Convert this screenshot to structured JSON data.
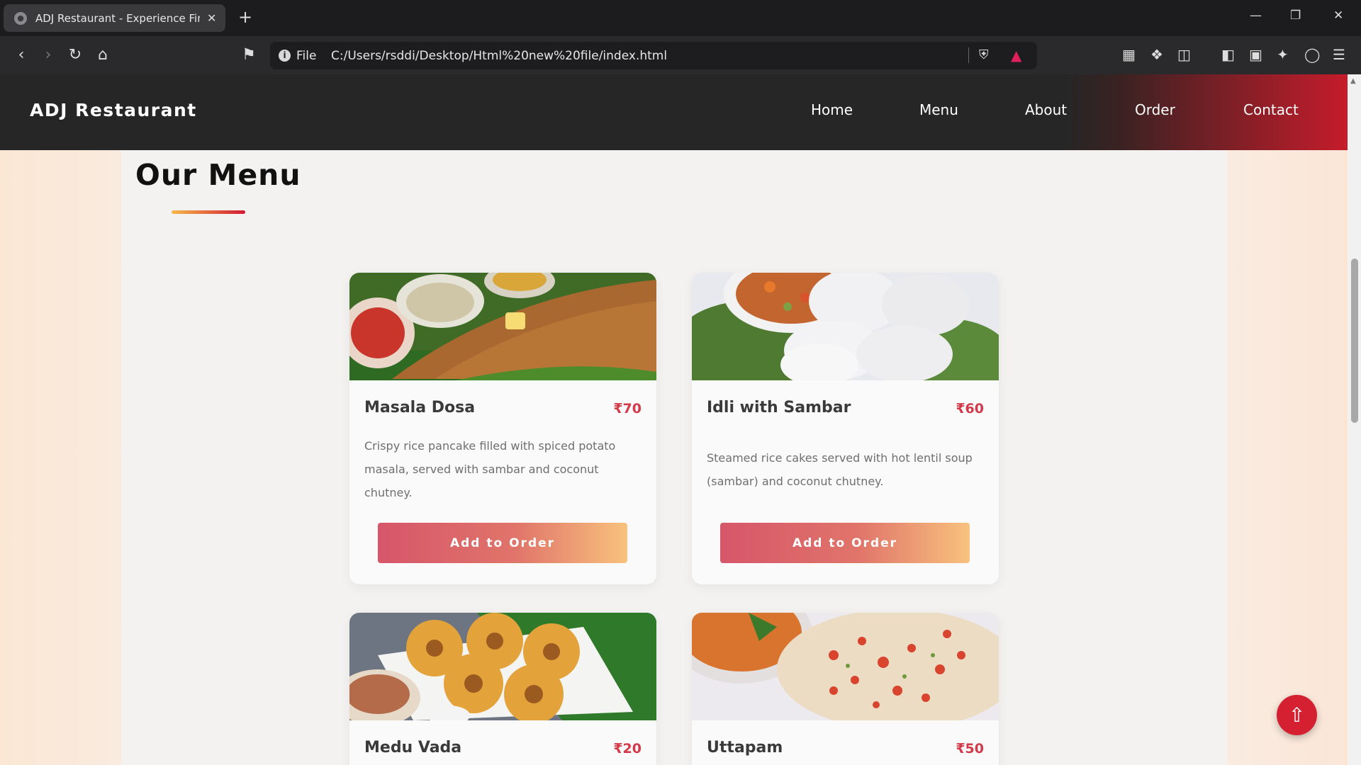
{
  "browser": {
    "tab_title": "ADJ Restaurant - Experience Fine",
    "url_scheme": "File",
    "url_path": "C:/Users/rsddi/Desktop/Html%20new%20file/index.html"
  },
  "site": {
    "brand": "ADJ Restaurant",
    "nav": [
      "Home",
      "Menu",
      "About",
      "Order",
      "Contact"
    ],
    "section_title": "Our Menu",
    "currency": "₹"
  },
  "menu": [
    {
      "name": "Masala Dosa",
      "price": "₹70",
      "description": "Crispy rice pancake filled with spiced potato masala, served with sambar and coconut chutney.",
      "button": "Add to Order"
    },
    {
      "name": "Idli with Sambar",
      "price": "₹60",
      "description": "Steamed rice cakes served with hot lentil soup (sambar) and coconut chutney.",
      "button": "Add to Order"
    },
    {
      "name": "Medu Vada",
      "price": "₹20"
    },
    {
      "name": "Uttapam",
      "price": "₹50"
    }
  ],
  "colors": {
    "accent": "#d42030",
    "price": "#d23a4a",
    "nav_bg": "#262626"
  }
}
